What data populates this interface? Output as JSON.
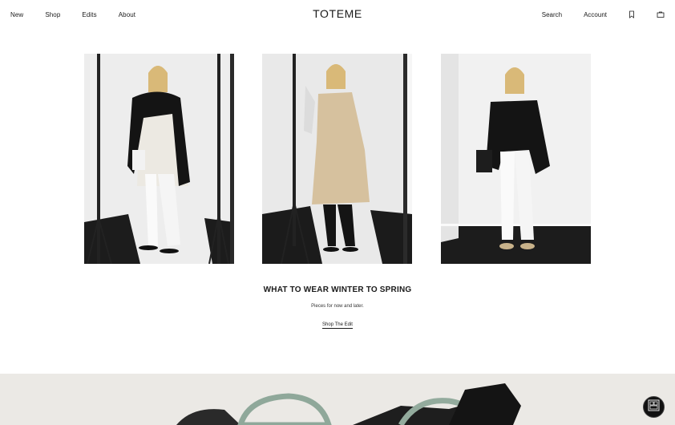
{
  "header": {
    "logo": "TOTEME",
    "nav_left": [
      "New",
      "Shop",
      "Edits",
      "About"
    ],
    "search_label": "Search",
    "account_label": "Account",
    "bookmark_icon": "bookmark-icon",
    "bag_icon": "shopping-bag-icon"
  },
  "edit": {
    "title": "WHAT TO WEAR WINTER TO SPRING",
    "subtitle": "Pieces for now and later.",
    "cta": "Shop The Edit"
  },
  "chat": {
    "icon": "chat-widget-icon"
  }
}
